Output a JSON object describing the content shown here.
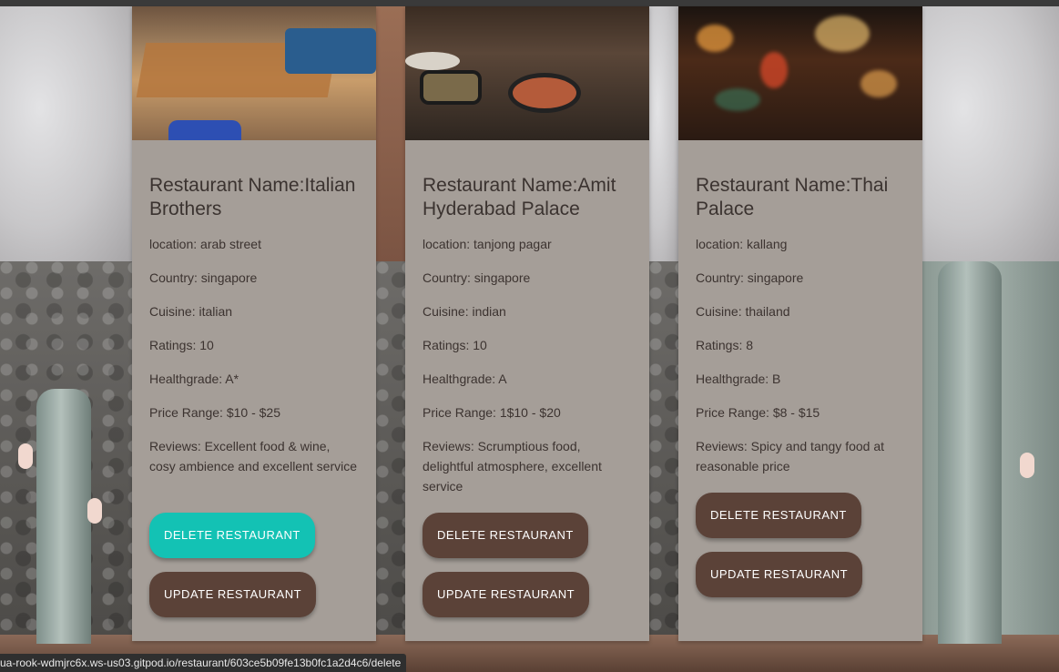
{
  "restaurants": [
    {
      "title": "Restaurant Name:Italian Brothers",
      "location": "location: arab street",
      "country": "Country: singapore",
      "cuisine": "Cuisine: italian",
      "ratings": "Ratings: 10",
      "healthgrade": "Healthgrade: A*",
      "price": "Price Range: $10 - $25",
      "reviews": "Reviews: Excellent food & wine, cosy ambience and excellent service"
    },
    {
      "title": "Restaurant Name:Amit Hyderabad Palace",
      "location": "location: tanjong pagar",
      "country": "Country: singapore",
      "cuisine": "Cuisine: indian",
      "ratings": "Ratings: 10",
      "healthgrade": "Healthgrade: A",
      "price": "Price Range: 1$10 - $20",
      "reviews": "Reviews: Scrumptious food, delightful atmosphere, excellent service"
    },
    {
      "title": "Restaurant Name:Thai Palace",
      "location": "location: kallang",
      "country": "Country: singapore",
      "cuisine": "Cuisine: thailand",
      "ratings": "Ratings: 8",
      "healthgrade": "Healthgrade: B",
      "price": "Price Range: $8 - $15",
      "reviews": "Reviews: Spicy and tangy food at reasonable price"
    }
  ],
  "buttons": {
    "delete_label": "DELETE RESTAURANT",
    "update_label": "UPDATE RESTAURANT"
  },
  "status_bar": {
    "url": "ua-rook-wdmjrc6x.ws-us03.gitpod.io/restaurant/603ce5b09fe13b0fc1a2d4c6/delete"
  },
  "colors": {
    "card_background": "#a59e98",
    "button_default": "#5b4238",
    "button_hover": "#13c2b4"
  }
}
